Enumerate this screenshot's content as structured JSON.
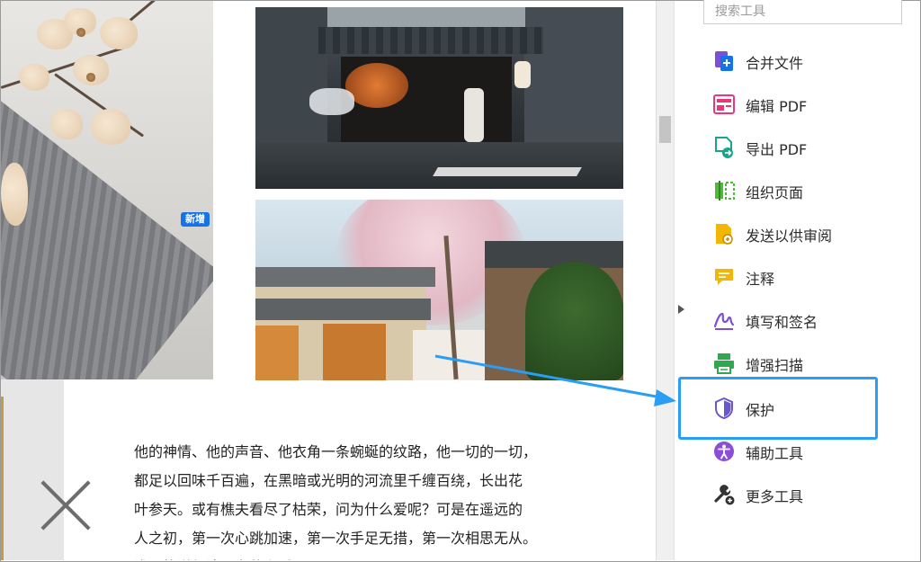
{
  "document": {
    "paragraph_lines": [
      "他的神情、他的声音、他衣角一条蜿蜒的纹路，他一切的一切，",
      "都足以回味千百遍，在黑暗或光明的河流里千缠百绕，长出花",
      "叶参天。或有樵夫看尽了枯荣，问为什么爱呢？可是在遥远的",
      "人之初，第一次心跳加速，第一次手足无措，第一次相思无从。",
      "谁又能说得清，为什么爱呢？"
    ]
  },
  "tools": {
    "search_placeholder": "搜索工具",
    "new_badge": "新增",
    "items": [
      {
        "label": "合并文件",
        "icon": "combine-files-icon",
        "color": "#7b4fd6"
      },
      {
        "label": "编辑 PDF",
        "icon": "edit-pdf-icon",
        "color": "#e8377d"
      },
      {
        "label": "导出 PDF",
        "icon": "export-pdf-icon",
        "color": "#19a58c"
      },
      {
        "label": "组织页面",
        "icon": "organize-pages-icon",
        "color": "#51b83b"
      },
      {
        "label": "发送以供审阅",
        "icon": "send-for-review-icon",
        "color": "#f2b705"
      },
      {
        "label": "注释",
        "icon": "comment-icon",
        "color": "#f2b705"
      },
      {
        "label": "填写和签名",
        "icon": "fill-sign-icon",
        "color": "#7b4fd6"
      },
      {
        "label": "增强扫描",
        "icon": "enhance-scan-icon",
        "color": "#2fa84f"
      },
      {
        "label": "保护",
        "icon": "protect-shield-icon",
        "color": "#6a57c9"
      },
      {
        "label": "辅助工具",
        "icon": "accessibility-icon",
        "color": "#8a4fd6"
      },
      {
        "label": "更多工具",
        "icon": "more-tools-icon",
        "color": "#333333"
      }
    ]
  },
  "highlight": {
    "color": "#2a9df4",
    "target": "保护"
  }
}
